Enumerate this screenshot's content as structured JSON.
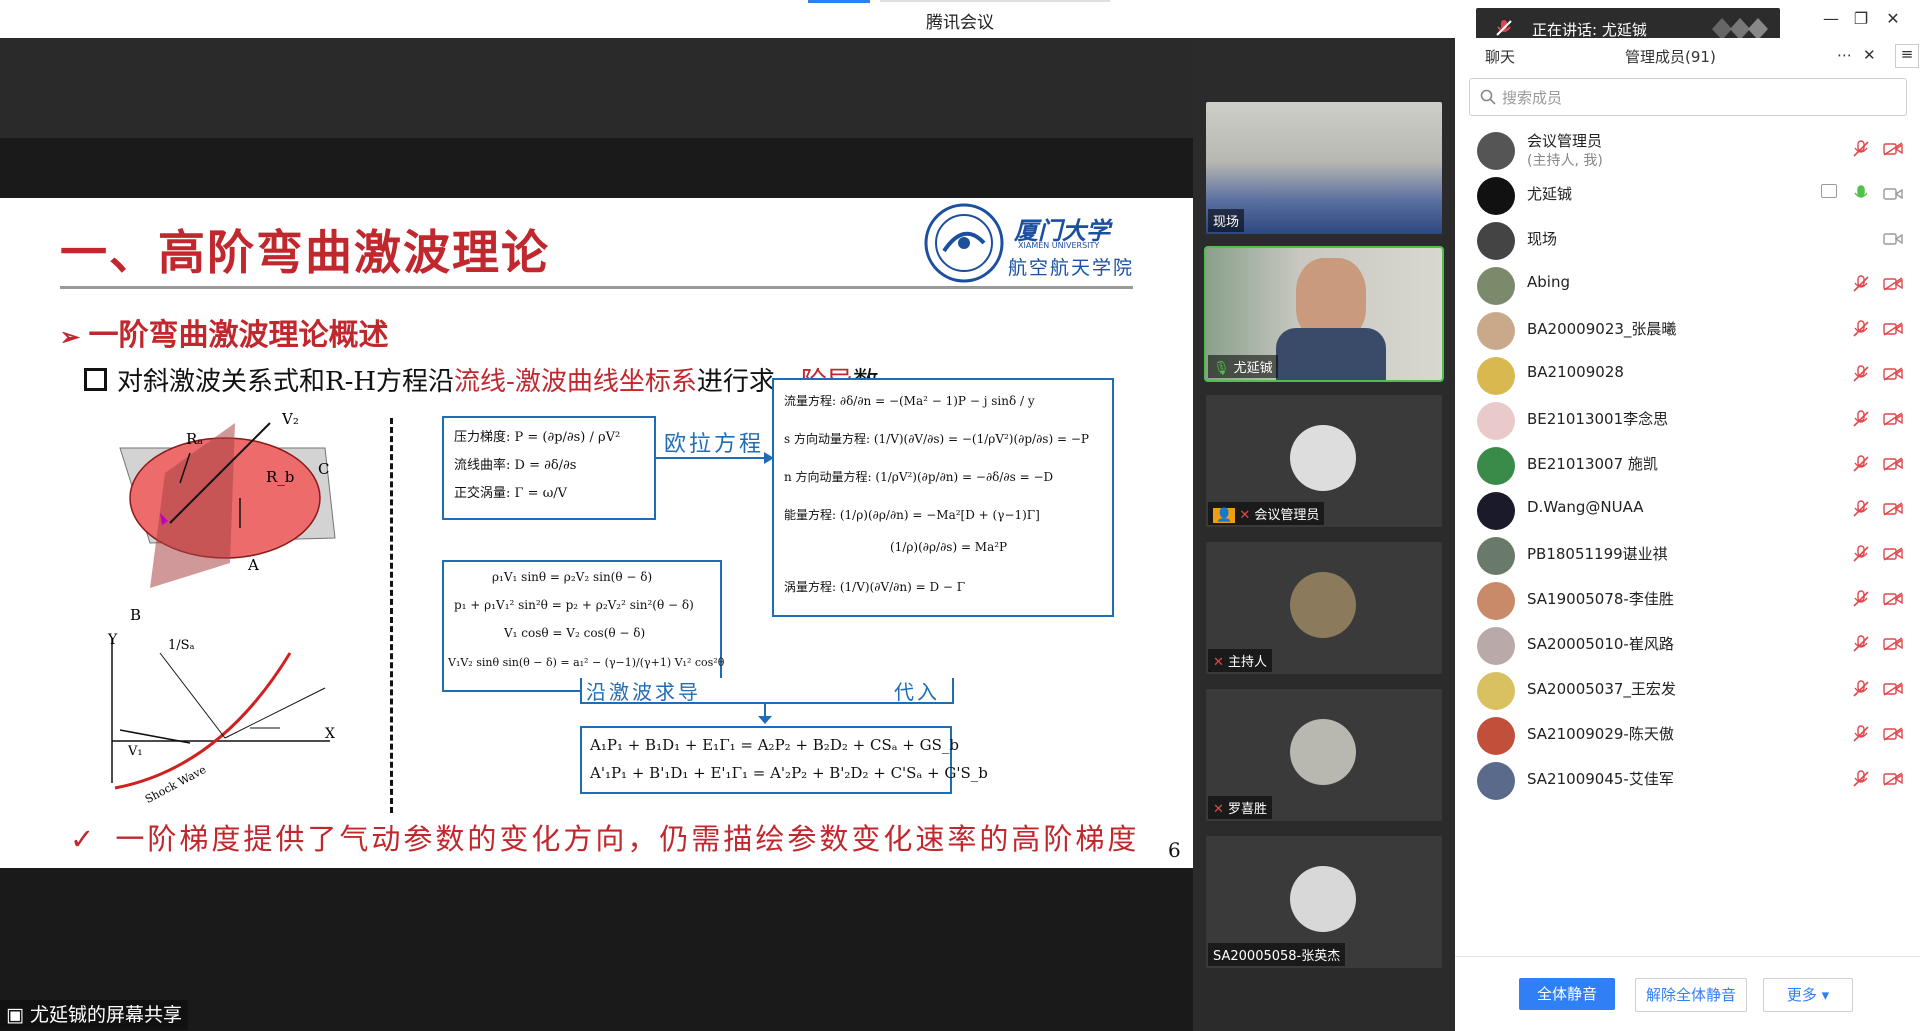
{
  "window": {
    "title": "腾讯会议"
  },
  "toast": {
    "label": "正在讲话: 尤延铖"
  },
  "slide": {
    "title": "一、高阶弯曲激波理论",
    "logo_cn": "厦门大学",
    "logo_en": "XIAMEN UNIVERSITY",
    "logo_dept": "航空航天学院",
    "subtitle": "一阶弯曲激波理论概述",
    "line1_a": "对斜激波关系式和R-H方程沿",
    "line1_red": "流线-激波曲线坐标系",
    "line1_b": "进行求",
    "line1_red2": "一阶导",
    "line1_c": "数",
    "euler_label": "欧拉方程",
    "along_shock_label": "沿激波求导",
    "substitute_label": "代入",
    "box1": [
      "压力梯度:  P = (∂p/∂s) / ρV²",
      "流线曲率:  D = ∂δ/∂s",
      "正交涡量:  Γ = ω/V"
    ],
    "box2": [
      "ρ₁V₁ sinθ = ρ₂V₂ sin(θ − δ)",
      "p₁ + ρ₁V₁² sin²θ = p₂ + ρ₂V₂² sin²(θ − δ)",
      "V₁ cosθ = V₂ cos(θ − δ)",
      "V₁V₂ sinθ sin(θ − δ) = a₁² − (γ−1)/(γ+1) V₁² cos²θ"
    ],
    "box3": [
      "流量方程:  ∂δ/∂n = −(Ma² − 1)P − j sinδ / y",
      "s 方向动量方程:  (1/V)(∂V/∂s) = −(1/ρV²)(∂p/∂s) = −P",
      "n 方向动量方程:  (1/ρV²)(∂p/∂n) = −∂δ/∂s = −D",
      "能量方程:  (1/ρ)(∂ρ/∂n) = −Ma²[D + (γ−1)Γ]",
      "(1/ρ)(∂ρ/∂s) = Ma²P",
      "涡量方程:  (1/V)(∂V/∂n) = D − Γ"
    ],
    "box4": [
      "A₁P₁ + B₁D₁ + E₁Γ₁ = A₂P₂ + B₂D₂ + CSₐ + GS_b",
      "A'₁P₁ + B'₁D₁ + E'₁Γ₁ = A'₂P₂ + B'₂D₂ + C'Sₐ + G'S_b"
    ],
    "bottom": "一阶梯度提供了气动参数的变化方向，仍需描绘参数变化速率的高阶梯度",
    "page": "6",
    "fig_labels": {
      "v2": "V₂",
      "ra": "Rₐ",
      "rb": "R_b",
      "c": "C",
      "a": "A",
      "b": "B",
      "y": "Y",
      "x": "X",
      "ssa": "1/Sₐ",
      "shock": "Shock Wave",
      "v1": "V₁"
    }
  },
  "share_label": "尤延铖的屏幕共享",
  "video_tiles": [
    {
      "name": "现场"
    },
    {
      "name": "尤延铖"
    },
    {
      "name": "会议管理员"
    },
    {
      "name": "主持人"
    },
    {
      "name": "罗喜胜"
    },
    {
      "name": "SA20005058-张英杰"
    }
  ],
  "panel": {
    "tab_chat": "聊天",
    "tab_members": "管理成员(91)",
    "search_placeholder": "搜索成员",
    "members": [
      {
        "name": "会议管理员",
        "sub": "(主持人, 我)"
      },
      {
        "name": "尤延铖"
      },
      {
        "name": "现场"
      },
      {
        "name": "Abing"
      },
      {
        "name": "BA20009023_张晨曦"
      },
      {
        "name": "BA21009028"
      },
      {
        "name": "BE21013001李念思"
      },
      {
        "name": "BE21013007 施凯"
      },
      {
        "name": "D.Wang@NUAA"
      },
      {
        "name": "PB18051199谌业祺"
      },
      {
        "name": "SA19005078-李佳胜"
      },
      {
        "name": "SA20005010-崔风路"
      },
      {
        "name": "SA20005037_王宏发"
      },
      {
        "name": "SA21009029-陈天傲"
      },
      {
        "name": "SA21009045-艾佳军"
      }
    ],
    "btn_mute_all": "全体静音",
    "btn_unmute_all": "解除全体静音",
    "btn_more": "更多 ▾"
  },
  "colors": {
    "accent": "#2f7ff5",
    "slide_red": "#c0282e",
    "box_blue": "#1f6eb5",
    "speaking_green": "#4dc247",
    "muted_red": "#e0474c"
  }
}
